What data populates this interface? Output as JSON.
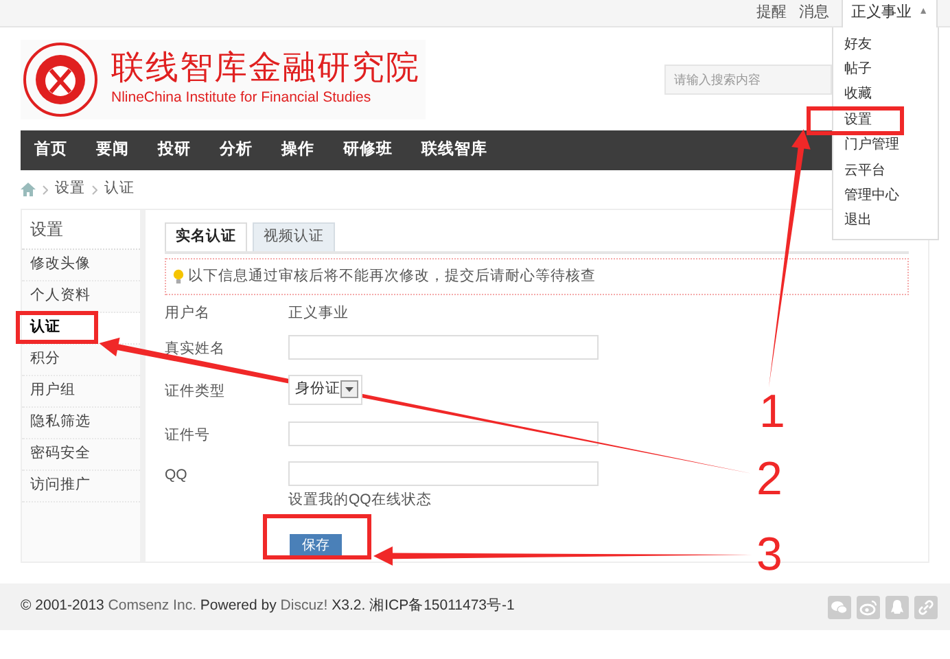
{
  "top_bar": {
    "links": [
      "提醒",
      "消息"
    ],
    "user_menu": {
      "label": "正义事业",
      "caret": "▲",
      "expanded": true
    }
  },
  "user_dropdown": {
    "items": [
      {
        "label": "好友"
      },
      {
        "label": "帖子"
      },
      {
        "label": "收藏"
      },
      {
        "label": "设置"
      },
      {
        "label": "门户管理"
      },
      {
        "label": "云平台"
      },
      {
        "label": "管理中心"
      },
      {
        "label": "退出"
      }
    ]
  },
  "header": {
    "logo_title": "联线智库金融研究院",
    "logo_subtitle": "NlineChina Institute for Financial Studies",
    "search": {
      "placeholder": "请输入搜索内容"
    }
  },
  "nav": {
    "items": [
      "首页",
      "要闻",
      "投研",
      "分析",
      "操作",
      "研修班",
      "联线智库"
    ]
  },
  "breadcrumb": [
    "设置",
    "认证"
  ],
  "sidebar": {
    "title": "设置",
    "items": [
      {
        "label": "修改头像",
        "selected": false
      },
      {
        "label": "个人资料",
        "selected": false
      },
      {
        "label": "认证",
        "selected": true
      },
      {
        "label": "积分",
        "selected": false
      },
      {
        "label": "用户组",
        "selected": false
      },
      {
        "label": "隐私筛选",
        "selected": false
      },
      {
        "label": "密码安全",
        "selected": false
      },
      {
        "label": "访问推广",
        "selected": false
      }
    ]
  },
  "tabs": [
    {
      "label": "实名认证",
      "selected": true
    },
    {
      "label": "视频认证",
      "selected": false
    }
  ],
  "notice": "以下信息通过审核后将不能再次修改，提交后请耐心等待核查",
  "form": {
    "rows": [
      {
        "kind": "text",
        "label": "用户名",
        "value": "正义事业"
      },
      {
        "kind": "input",
        "label": "真实姓名"
      },
      {
        "kind": "select",
        "label": "证件类型",
        "value": "身份证"
      },
      {
        "kind": "input",
        "label": "证件号"
      },
      {
        "kind": "input",
        "label": "QQ",
        "hint": "设置我的QQ在线状态"
      }
    ],
    "save_button": "保存"
  },
  "footer": {
    "text_before": "© 2001-2013",
    "link_1": "Comsenz Inc.",
    "text_middle": "Powered by",
    "link_2": "Discuz!",
    "text_after": "X3.2. 湘ICP备15011473号-1"
  },
  "annotations": [
    {
      "number": "1"
    },
    {
      "number": "2"
    },
    {
      "number": "3"
    }
  ]
}
